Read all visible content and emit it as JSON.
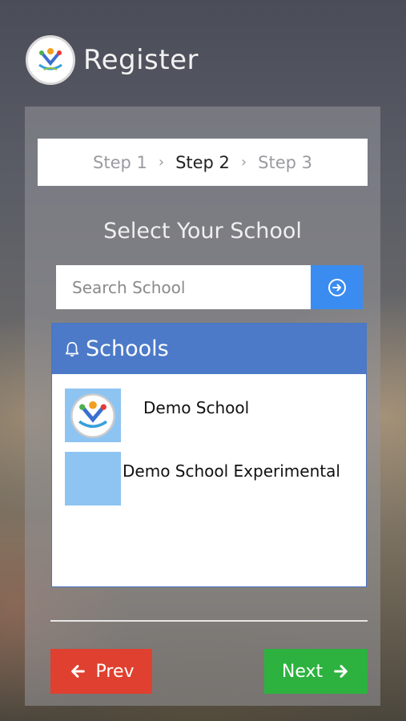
{
  "header": {
    "title": "Register"
  },
  "steps": {
    "step1": "Step 1",
    "step2": "Step 2",
    "step3": "Step 3",
    "separator": "›"
  },
  "heading": "Select Your School",
  "search": {
    "placeholder": "Search School",
    "value": ""
  },
  "schools": {
    "title": "Schools",
    "items": [
      {
        "name": "Demo School",
        "has_logo": true
      },
      {
        "name": "Demo School Experimental",
        "has_logo": false
      }
    ]
  },
  "nav": {
    "prev_label": "Prev",
    "next_label": "Next"
  },
  "colors": {
    "accent_blue": "#3b8cf0",
    "header_blue": "#4c7ac8",
    "prev_red": "#e0402f",
    "next_green": "#2db23f"
  }
}
